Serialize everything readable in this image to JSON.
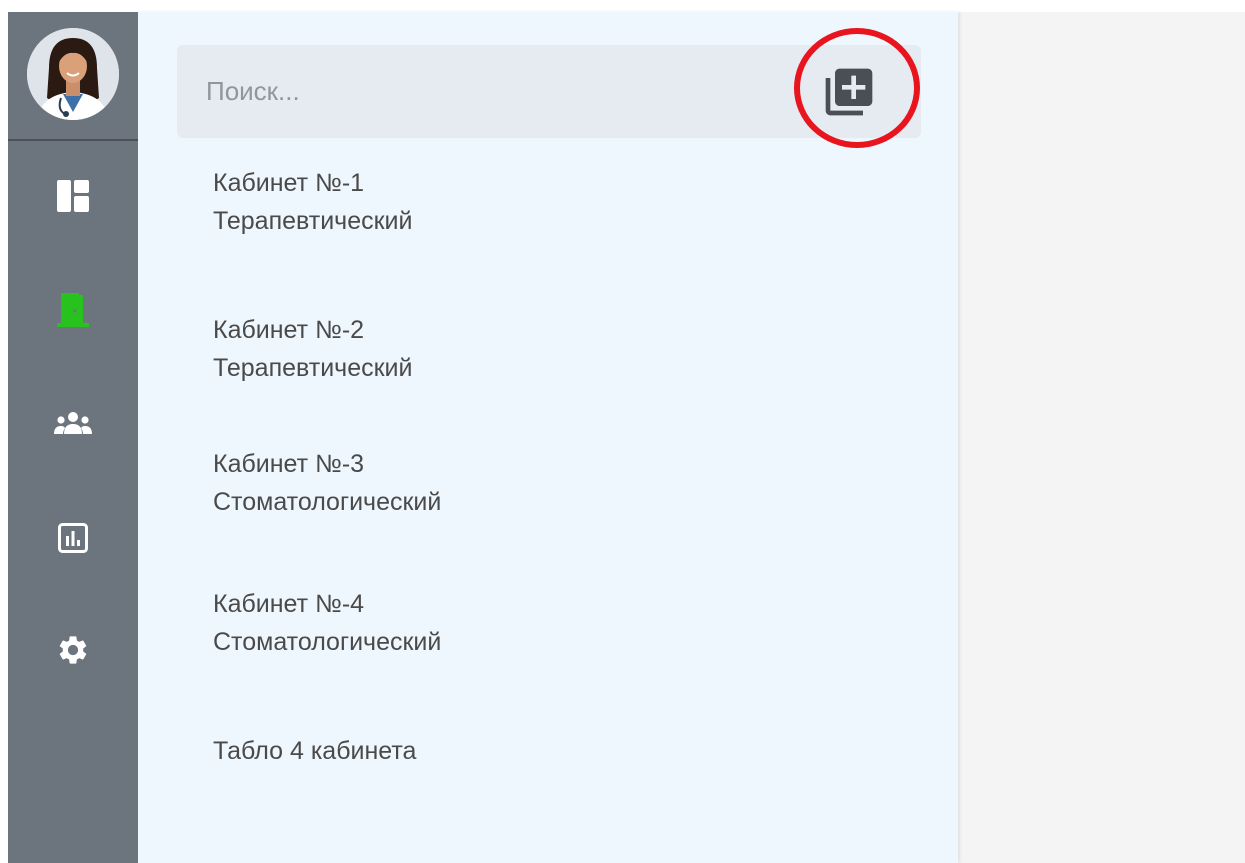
{
  "sidebar": {
    "avatar_alt": "doctor-avatar",
    "items": [
      {
        "name": "dashboard",
        "icon": "dashboard-icon",
        "color": "#ffffff"
      },
      {
        "name": "cabinets",
        "icon": "door-icon",
        "color": "#28c21e",
        "active": true
      },
      {
        "name": "users",
        "icon": "users-icon",
        "color": "#ffffff"
      },
      {
        "name": "reports",
        "icon": "chart-icon",
        "color": "#ffffff"
      },
      {
        "name": "settings",
        "icon": "gear-icon",
        "color": "#ffffff"
      }
    ]
  },
  "search": {
    "placeholder": "Поиск...",
    "value": ""
  },
  "add_button": {
    "icon": "add-to-library-icon",
    "highlight_color": "#e8141e"
  },
  "list": {
    "items": [
      {
        "title": "Кабинет №-1",
        "subtitle": "Терапевтический"
      },
      {
        "title": "Кабинет №-2",
        "subtitle": "Терапевтический"
      },
      {
        "title": "Кабинет №-3",
        "subtitle": "Стоматологический"
      },
      {
        "title": "Кабинет №-4",
        "subtitle": "Стоматологический"
      },
      {
        "title": "Табло 4 кабинета"
      }
    ]
  },
  "colors": {
    "rail_bg": "#6c757d",
    "panel_bg": "#eff7fe",
    "content_bg": "#f4f4f4",
    "active_icon": "#28c21e"
  }
}
